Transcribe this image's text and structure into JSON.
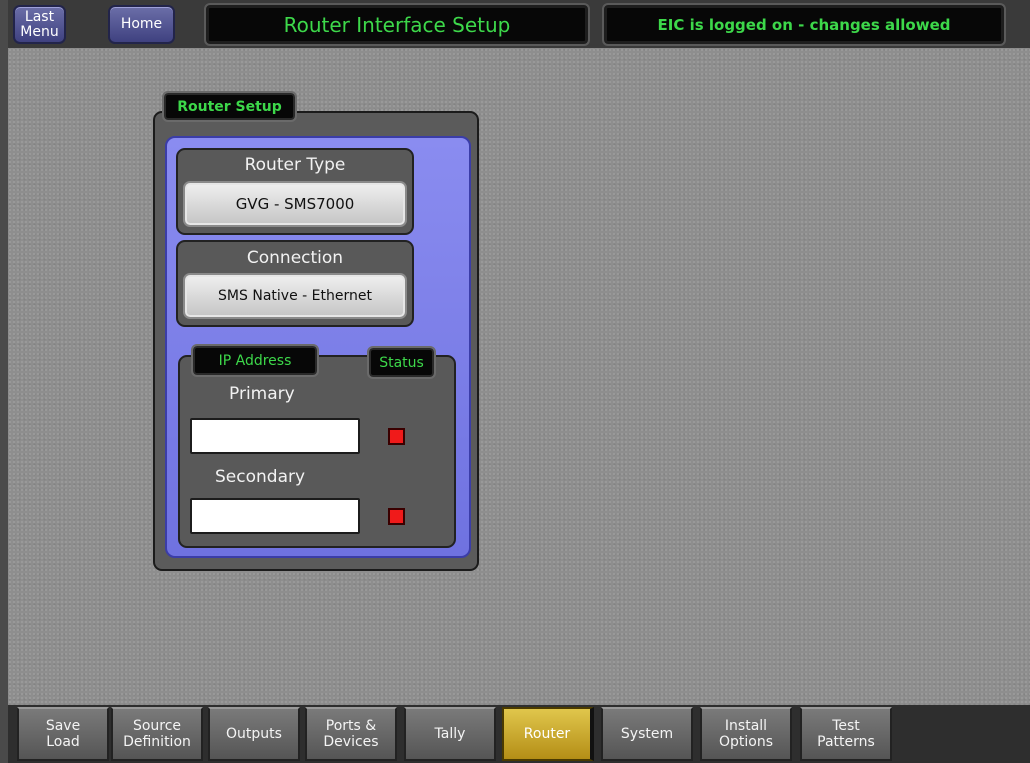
{
  "header": {
    "last_menu_label": "Last\nMenu",
    "home_label": "Home",
    "title": "Router Interface Setup",
    "status": "EIC is logged on - changes allowed"
  },
  "panel": {
    "tab_label": "Router Setup",
    "router_type": {
      "title": "Router Type",
      "value": "GVG - SMS7000"
    },
    "connection": {
      "title": "Connection",
      "value": "SMS Native - Ethernet"
    },
    "ip": {
      "tab_ip": "IP Address",
      "tab_status": "Status",
      "primary_label": "Primary",
      "primary_value": "",
      "secondary_label": "Secondary",
      "secondary_value": ""
    },
    "status_color": "#f01a1a"
  },
  "bottom_tabs": [
    {
      "label": "Save\nLoad"
    },
    {
      "label": "Source\nDefinition"
    },
    {
      "label": "Outputs"
    },
    {
      "label": "Ports &\nDevices"
    },
    {
      "label": "Tally"
    },
    {
      "label": "Router",
      "active": true
    },
    {
      "label": "System"
    },
    {
      "label": "Install\nOptions"
    },
    {
      "label": "Test\nPatterns"
    }
  ],
  "colors": {
    "accent_green": "#3dd84a",
    "panel_purple": "#7c7fe8",
    "active_tab": "#d4b030"
  }
}
